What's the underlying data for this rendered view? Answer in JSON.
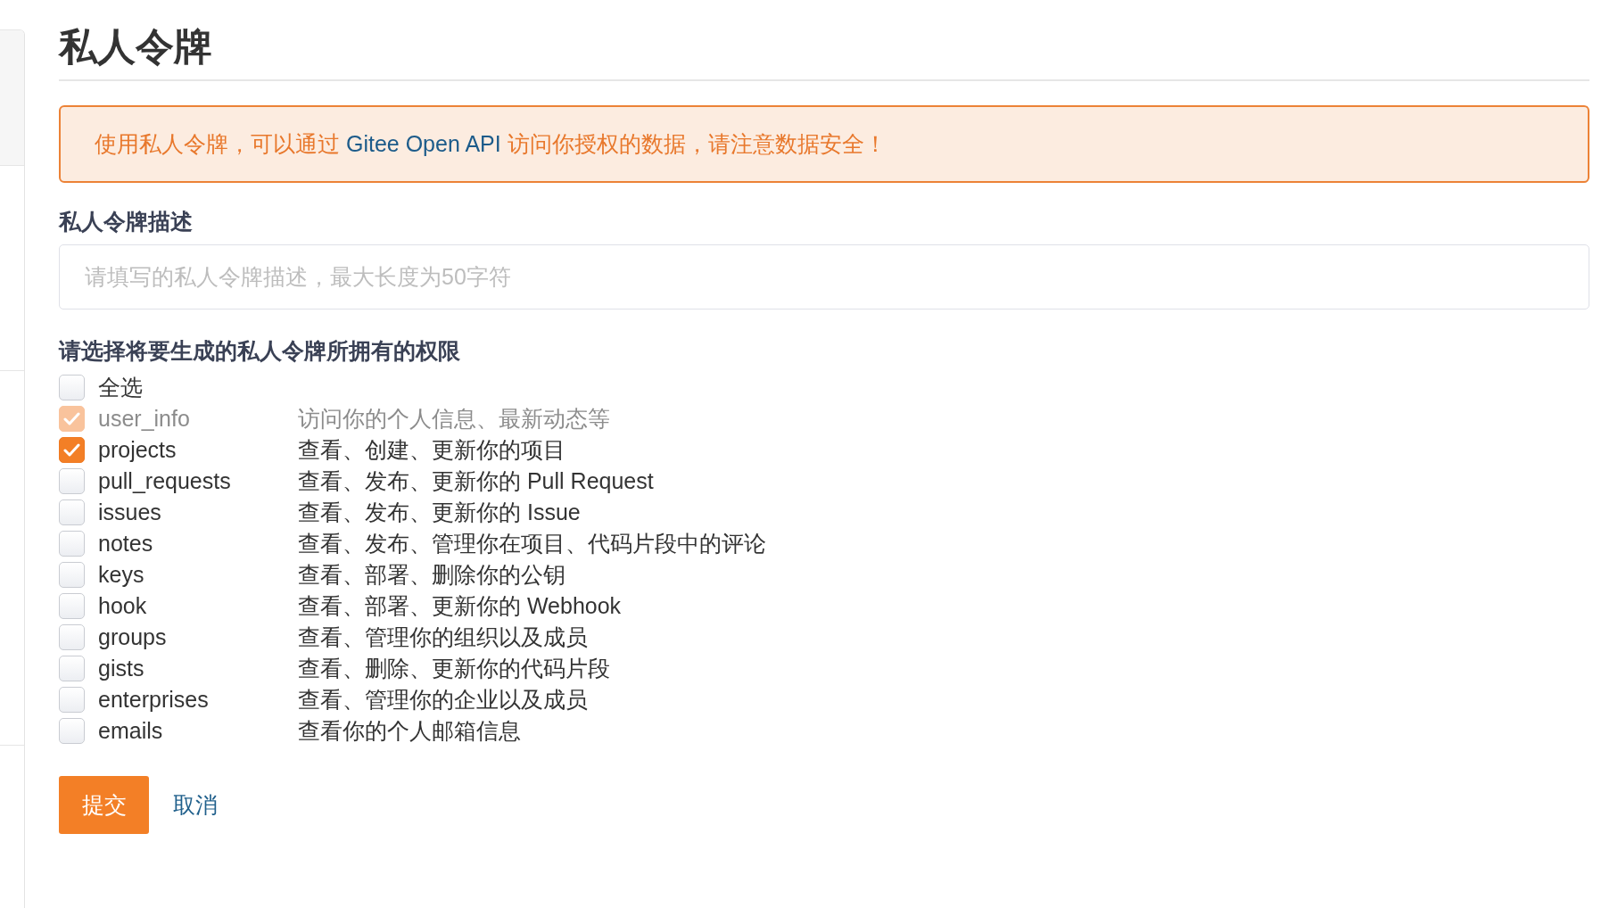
{
  "page": {
    "title": "私人令牌"
  },
  "notice": {
    "before": "使用私人令牌，可以通过",
    "link": "Gitee Open API",
    "after": "访问你授权的数据，请注意数据安全！"
  },
  "description_field": {
    "label": "私人令牌描述",
    "placeholder": "请填写的私人令牌描述，最大长度为50字符"
  },
  "permissions": {
    "label": "请选择将要生成的私人令牌所拥有的权限",
    "select_all": {
      "label": "全选",
      "checked": false
    },
    "scopes": [
      {
        "name": "user_info",
        "description": "访问你的个人信息、最新动态等",
        "checked": true,
        "disabled": true
      },
      {
        "name": "projects",
        "description": "查看、创建、更新你的项目",
        "checked": true,
        "disabled": false
      },
      {
        "name": "pull_requests",
        "description": "查看、发布、更新你的 Pull Request",
        "checked": false,
        "disabled": false
      },
      {
        "name": "issues",
        "description": "查看、发布、更新你的 Issue",
        "checked": false,
        "disabled": false
      },
      {
        "name": "notes",
        "description": "查看、发布、管理你在项目、代码片段中的评论",
        "checked": false,
        "disabled": false
      },
      {
        "name": "keys",
        "description": "查看、部署、删除你的公钥",
        "checked": false,
        "disabled": false
      },
      {
        "name": "hook",
        "description": "查看、部署、更新你的 Webhook",
        "checked": false,
        "disabled": false
      },
      {
        "name": "groups",
        "description": "查看、管理你的组织以及成员",
        "checked": false,
        "disabled": false
      },
      {
        "name": "gists",
        "description": "查看、删除、更新你的代码片段",
        "checked": false,
        "disabled": false
      },
      {
        "name": "enterprises",
        "description": "查看、管理你的企业以及成员",
        "checked": false,
        "disabled": false
      },
      {
        "name": "emails",
        "description": "查看你的个人邮箱信息",
        "checked": false,
        "disabled": false
      }
    ]
  },
  "actions": [
    {
      "label": "提交",
      "kind": "primary"
    },
    {
      "label": "取消",
      "kind": "link"
    }
  ]
}
